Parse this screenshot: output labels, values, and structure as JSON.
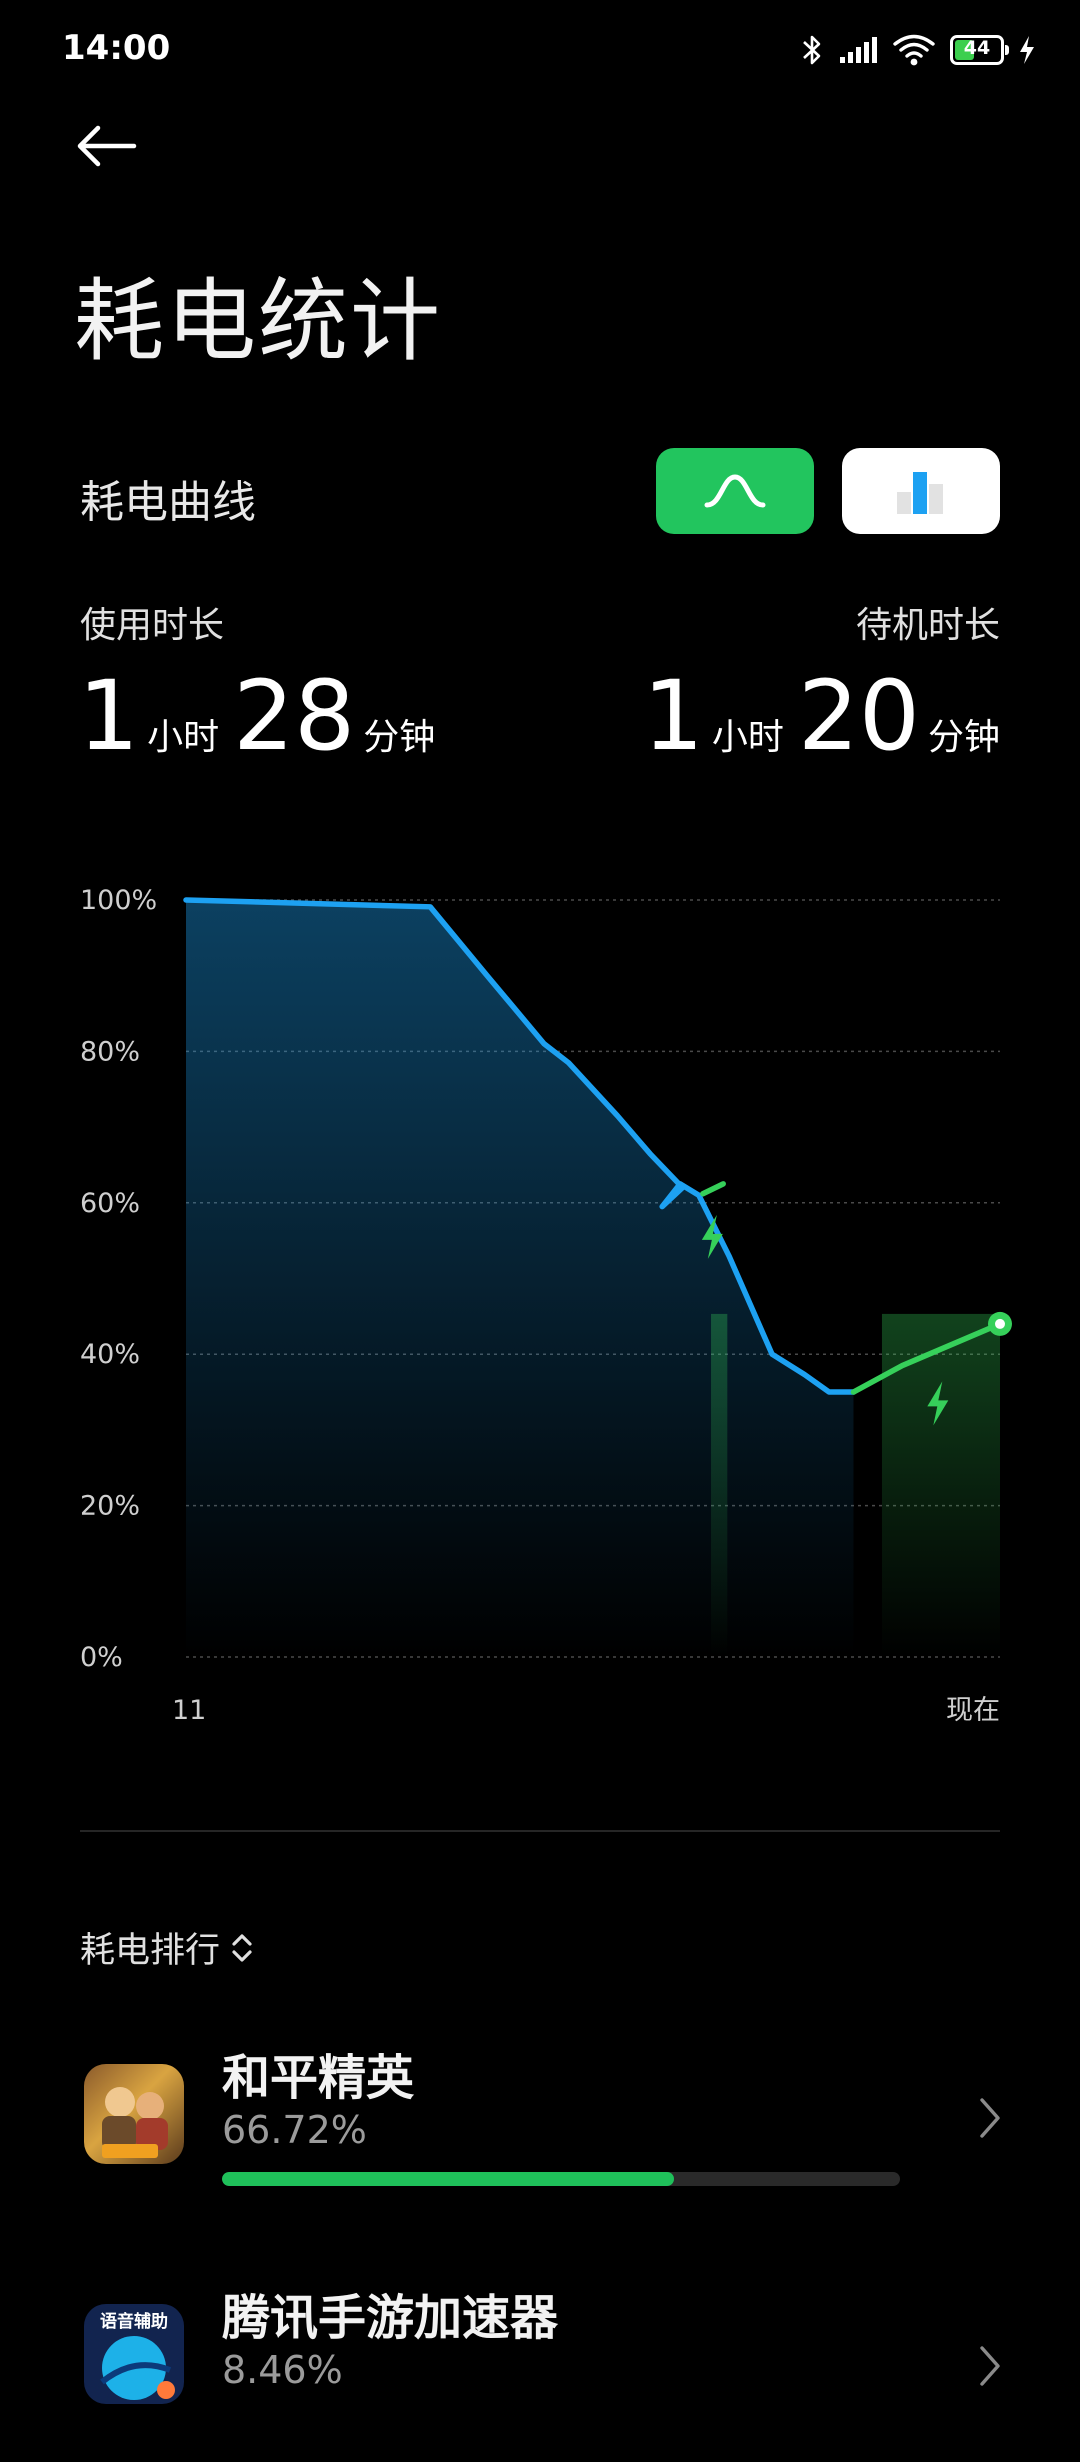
{
  "status_bar": {
    "time": "14:00",
    "battery_level": "44",
    "icons": [
      "bluetooth-icon",
      "signal-icon",
      "wifi-icon",
      "battery-icon",
      "charging-icon"
    ]
  },
  "header": {
    "back_icon": "arrow-left-icon",
    "title": "耗电统计"
  },
  "curve_section": {
    "label": "耗电曲线",
    "toggle_curve_icon": "curve-icon",
    "toggle_bar_icon": "bar-chart-icon",
    "active": "curve"
  },
  "usage": {
    "label": "使用时长",
    "hours": "1",
    "hour_unit": "小时",
    "minutes": "28",
    "minute_unit": "分钟"
  },
  "standby": {
    "label": "待机时长",
    "hours": "1",
    "hour_unit": "小时",
    "minutes": "20",
    "minute_unit": "分钟"
  },
  "chart_data": {
    "type": "area",
    "y_ticks": [
      "100%",
      "80%",
      "60%",
      "40%",
      "20%",
      "0%"
    ],
    "x_ticks": [
      "11",
      "现在"
    ],
    "ylim": [
      0,
      100
    ],
    "xlim": [
      0,
      100
    ],
    "grid": true,
    "series": [
      {
        "status": "discharging",
        "color": "#1da1f2",
        "x": [
          0,
          30,
          37,
          44,
          47,
          53,
          57,
          61,
          58.5,
          60.7,
          63,
          66.7,
          72,
          76,
          79,
          82
        ],
        "y": [
          100,
          99.1,
          90,
          81,
          78.5,
          71.5,
          66.5,
          62,
          59.5,
          62.5,
          61,
          53,
          40,
          37.3,
          35,
          35
        ]
      },
      {
        "status": "charging",
        "color": "#36d05a",
        "x": [
          63.5,
          66,
          88,
          100
        ],
        "y": [
          61.2,
          62.5,
          38.5,
          44
        ]
      }
    ],
    "charging_periods": [
      [
        64.5,
        66.5
      ],
      [
        85.5,
        100
      ]
    ],
    "current_level_percent": 44
  },
  "ranking": {
    "title": "耗电排行",
    "sort_icon": "sort-updown-icon",
    "apps": [
      {
        "name": "和平精英",
        "percent": "66.72%",
        "fraction": 0.6672,
        "icon": "game-icon"
      },
      {
        "name": "腾讯手游加速器",
        "percent": "8.46%",
        "fraction": 0.0846,
        "icon": "accelerator-icon",
        "icon_text": "语音辅助"
      }
    ]
  },
  "colors": {
    "accent_green": "#22c55e",
    "line_blue": "#1da1f2",
    "line_green": "#36d05a",
    "background": "#000000"
  }
}
